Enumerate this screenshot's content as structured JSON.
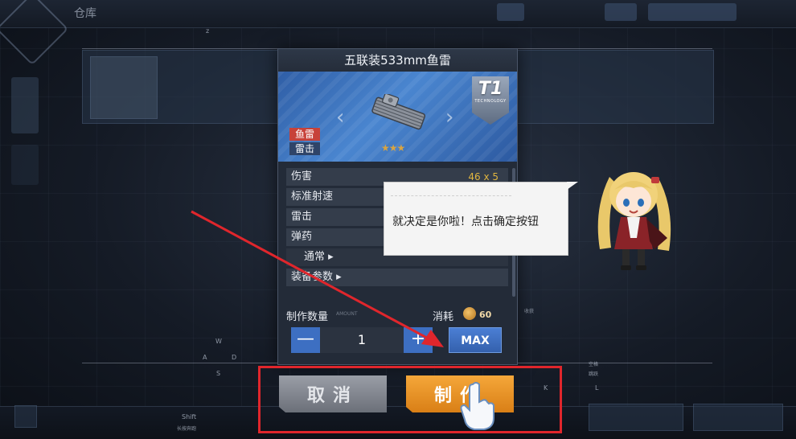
{
  "background": {
    "top_title": "仓库",
    "top_right_buttons": [
      "",
      "",
      ""
    ],
    "axis_label_z": "z",
    "wasd": {
      "w": "W",
      "a": "A",
      "s": "S",
      "d": "D"
    },
    "shift_label": "Shift",
    "shift_sub": "长按奔跑",
    "k_label": "K",
    "l_label": "L",
    "space_label": "空格",
    "space_sub": "跳跃",
    "mouse_label": "收获"
  },
  "dialog": {
    "title": "五联装533mm鱼雷",
    "tier": "T1",
    "tier_sub": "TECHNOLOGY",
    "tags": [
      "鱼雷",
      "雷击"
    ],
    "stars": "★★★",
    "stats": [
      {
        "label": "伤害",
        "value": "46 x 5"
      },
      {
        "label": "标准射速",
        "value": ""
      },
      {
        "label": "雷击",
        "value": ""
      },
      {
        "label": "弹药",
        "value": ""
      },
      {
        "label": "通常 ▸",
        "value": "",
        "sub": true
      },
      {
        "label": "装备参数 ▸",
        "value": ""
      }
    ],
    "quantity_label": "制作数量",
    "amount_tag": "AMOUNT",
    "cost_label": "消耗",
    "cost_value": "60",
    "quantity_value": "1",
    "minus_label": "—",
    "plus_label": "+",
    "max_label": "MAX"
  },
  "bubble": {
    "text": "就决定是你啦！点击确定按钮"
  },
  "actions": {
    "cancel_label": "取消",
    "make_label": "制作"
  },
  "colors": {
    "accent_blue": "#3d6fc2",
    "make_orange": "#e8921f",
    "highlight_red": "#e0262c",
    "stat_gold": "#e0b53f"
  }
}
